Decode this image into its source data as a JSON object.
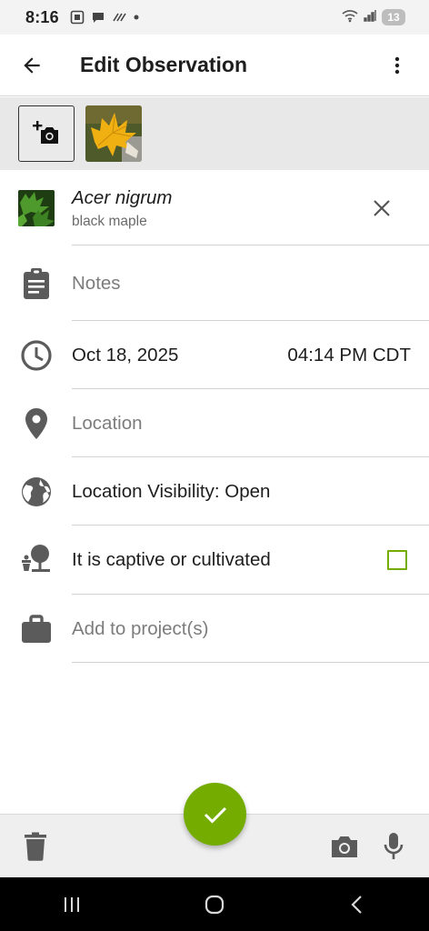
{
  "status_bar": {
    "time": "8:16",
    "battery": "13",
    "icons": [
      "screenshot-icon",
      "chat-icon",
      "stripes-icon",
      "dot-icon",
      "wifi-icon",
      "signal-icon",
      "battery-icon"
    ]
  },
  "app_bar": {
    "title": "Edit Observation",
    "back_icon": "arrow-back-icon",
    "more_icon": "more-vertical-icon"
  },
  "photos": {
    "add_icon": "add-photo-icon",
    "thumbnail": "yellow-maple-leaf-photo"
  },
  "taxon": {
    "scientific_name": "Acer nigrum",
    "common_name": "black maple",
    "clear_icon": "close-icon"
  },
  "notes": {
    "placeholder": "Notes",
    "icon": "clipboard-icon"
  },
  "datetime": {
    "date": "Oct 18, 2025",
    "time": "04:14 PM CDT",
    "icon": "clock-icon"
  },
  "location": {
    "placeholder": "Location",
    "icon": "map-pin-icon"
  },
  "visibility": {
    "label": "Location Visibility: Open",
    "icon": "globe-icon"
  },
  "captive": {
    "label": "It is captive or cultivated",
    "checked": false,
    "icon": "potted-tree-icon"
  },
  "projects": {
    "placeholder": "Add to project(s)",
    "icon": "briefcase-icon"
  },
  "bottom_bar": {
    "delete_icon": "trash-icon",
    "save_icon": "check-icon",
    "camera_icon": "camera-icon",
    "mic_icon": "microphone-icon"
  },
  "colors": {
    "accent": "#74ac00",
    "icon": "#5b5b5b"
  },
  "nav_bar": {
    "icons": [
      "recent-apps-icon",
      "home-icon",
      "back-icon"
    ]
  }
}
